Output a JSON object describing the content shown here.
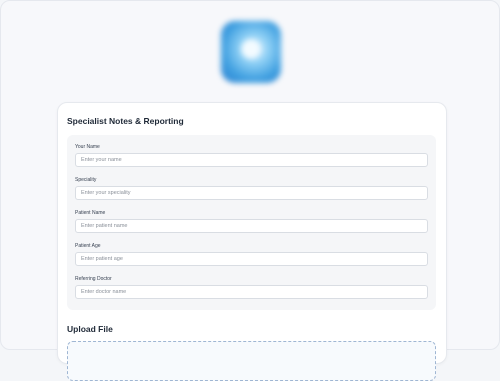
{
  "form": {
    "title": "Specialist Notes & Reporting",
    "fields": [
      {
        "label": "Your Name",
        "placeholder": "Enter your name"
      },
      {
        "label": "Speciality",
        "placeholder": "Enter your speciality"
      },
      {
        "label": "Patient Name",
        "placeholder": "Enter patient name"
      },
      {
        "label": "Patient Age",
        "placeholder": "Enter patient age"
      },
      {
        "label": "Referring Doctor",
        "placeholder": "Enter doctor name"
      }
    ]
  },
  "upload": {
    "title": "Upload File"
  },
  "colors": {
    "logo": "#3f9fe0",
    "dropzone_border": "#9fb6d3"
  }
}
